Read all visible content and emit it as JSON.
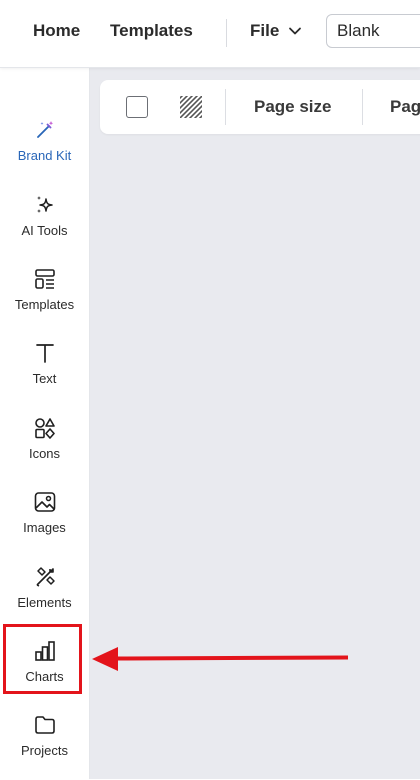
{
  "header": {
    "nav": {
      "home": "Home",
      "templates": "Templates",
      "file": "File"
    },
    "document_name_value": "Blank"
  },
  "sidebar": {
    "items": [
      {
        "label": "Brand Kit",
        "icon": "magic-wand-icon"
      },
      {
        "label": "AI Tools",
        "icon": "sparkles-icon"
      },
      {
        "label": "Templates",
        "icon": "templates-icon"
      },
      {
        "label": "Text",
        "icon": "text-icon"
      },
      {
        "label": "Icons",
        "icon": "shapes-icon"
      },
      {
        "label": "Images",
        "icon": "image-icon"
      },
      {
        "label": "Elements",
        "icon": "elements-icon"
      },
      {
        "label": "Charts",
        "icon": "bar-chart-icon"
      },
      {
        "label": "Projects",
        "icon": "folder-icon"
      }
    ],
    "active_index": 0
  },
  "toolbar": {
    "page_size_label": "Page size",
    "truncated_label": "Pag"
  },
  "colors": {
    "accent": "#2966b8",
    "highlight": "#e3141b",
    "canvas_bg": "#e9eaef"
  }
}
